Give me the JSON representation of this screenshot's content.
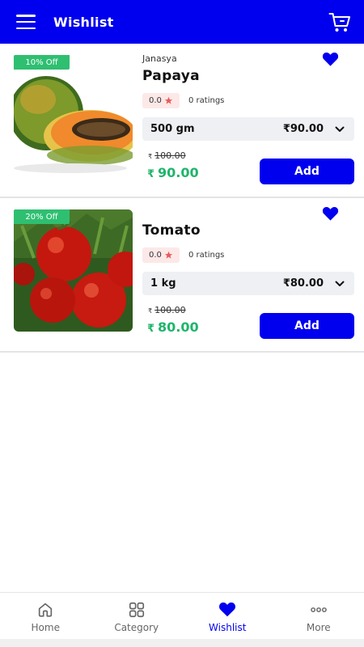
{
  "app": {
    "title": "Wishlist"
  },
  "icons": {
    "menu": "hamburger-menu-icon",
    "cart": "cart-icon",
    "heart": "heart-icon",
    "star": "star-icon",
    "chevron": "chevron-down-icon"
  },
  "colors": {
    "primary": "#0000ee",
    "discount_badge": "#2fbf71",
    "sale_price": "#1fb56b",
    "rating_bg": "#fde8e8",
    "star": "#e85a5a"
  },
  "products": [
    {
      "badge": "10% Off",
      "brand": "Janasya",
      "name": "Papaya",
      "rating": "0.0",
      "ratings_count": "0 ratings",
      "variant_size": "500 gm",
      "variant_price": "₹90.00",
      "mrp_symbol": "₹",
      "mrp": "100.00",
      "sale_symbol": "₹",
      "sale_price": "90.00",
      "add_label": "Add",
      "wishlisted": true
    },
    {
      "badge": "20% Off",
      "brand": "",
      "name": "Tomato",
      "rating": "0.0",
      "ratings_count": "0 ratings",
      "variant_size": "1 kg",
      "variant_price": "₹80.00",
      "mrp_symbol": "₹",
      "mrp": "100.00",
      "sale_symbol": "₹",
      "sale_price": "80.00",
      "add_label": "Add",
      "wishlisted": true
    }
  ],
  "nav": {
    "active": "Wishlist",
    "items": [
      {
        "label": "Home",
        "icon": "home-icon"
      },
      {
        "label": "Category",
        "icon": "grid-icon"
      },
      {
        "label": "Wishlist",
        "icon": "heart-icon"
      },
      {
        "label": "More",
        "icon": "more-dots-icon"
      }
    ]
  }
}
